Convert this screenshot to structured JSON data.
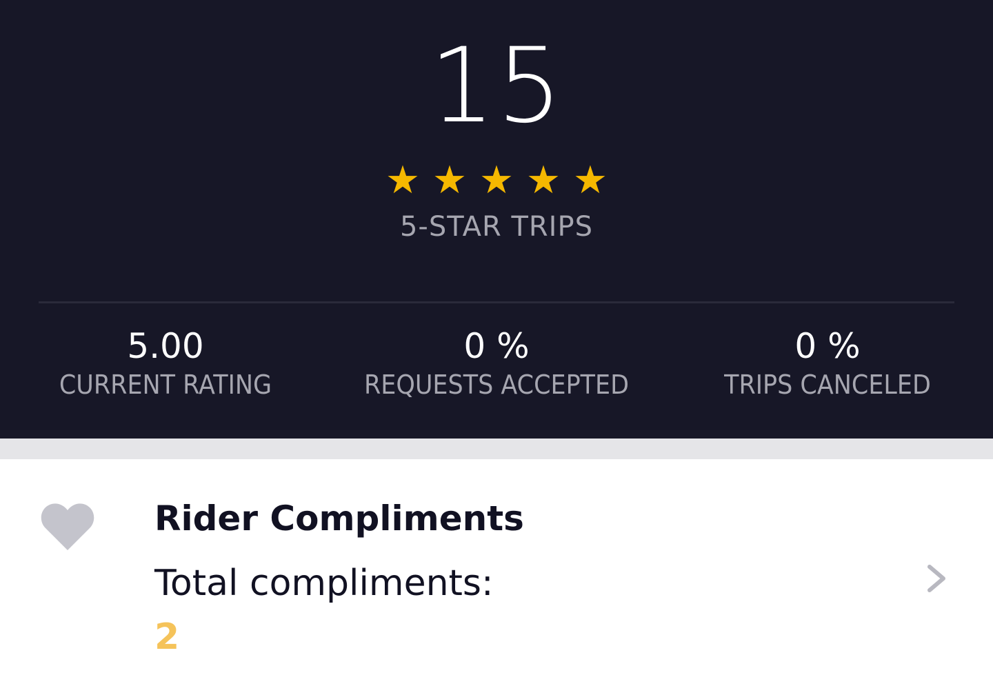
{
  "summary": {
    "five_star_trip_count": "15",
    "star_rating_shown": 5,
    "stars": [
      "★",
      "★",
      "★",
      "★",
      "★"
    ],
    "five_star_label": "5-STAR TRIPS"
  },
  "stats": [
    {
      "value": "5.00",
      "label": "CURRENT RATING"
    },
    {
      "value": "0 %",
      "label": "REQUESTS ACCEPTED"
    },
    {
      "value": "0 %",
      "label": "TRIPS CANCELED"
    }
  ],
  "compliments": {
    "icon": "heart-icon",
    "title": "Rider Compliments",
    "total_label": "Total compliments:",
    "total_value": "2",
    "nav_icon": "chevron-right-icon"
  },
  "colors": {
    "panel_background": "#171727",
    "star": "#f5b800",
    "accent_value": "#f5c35a",
    "muted_text": "#a6a6b0",
    "icon_gray": "#c4c4cc"
  }
}
